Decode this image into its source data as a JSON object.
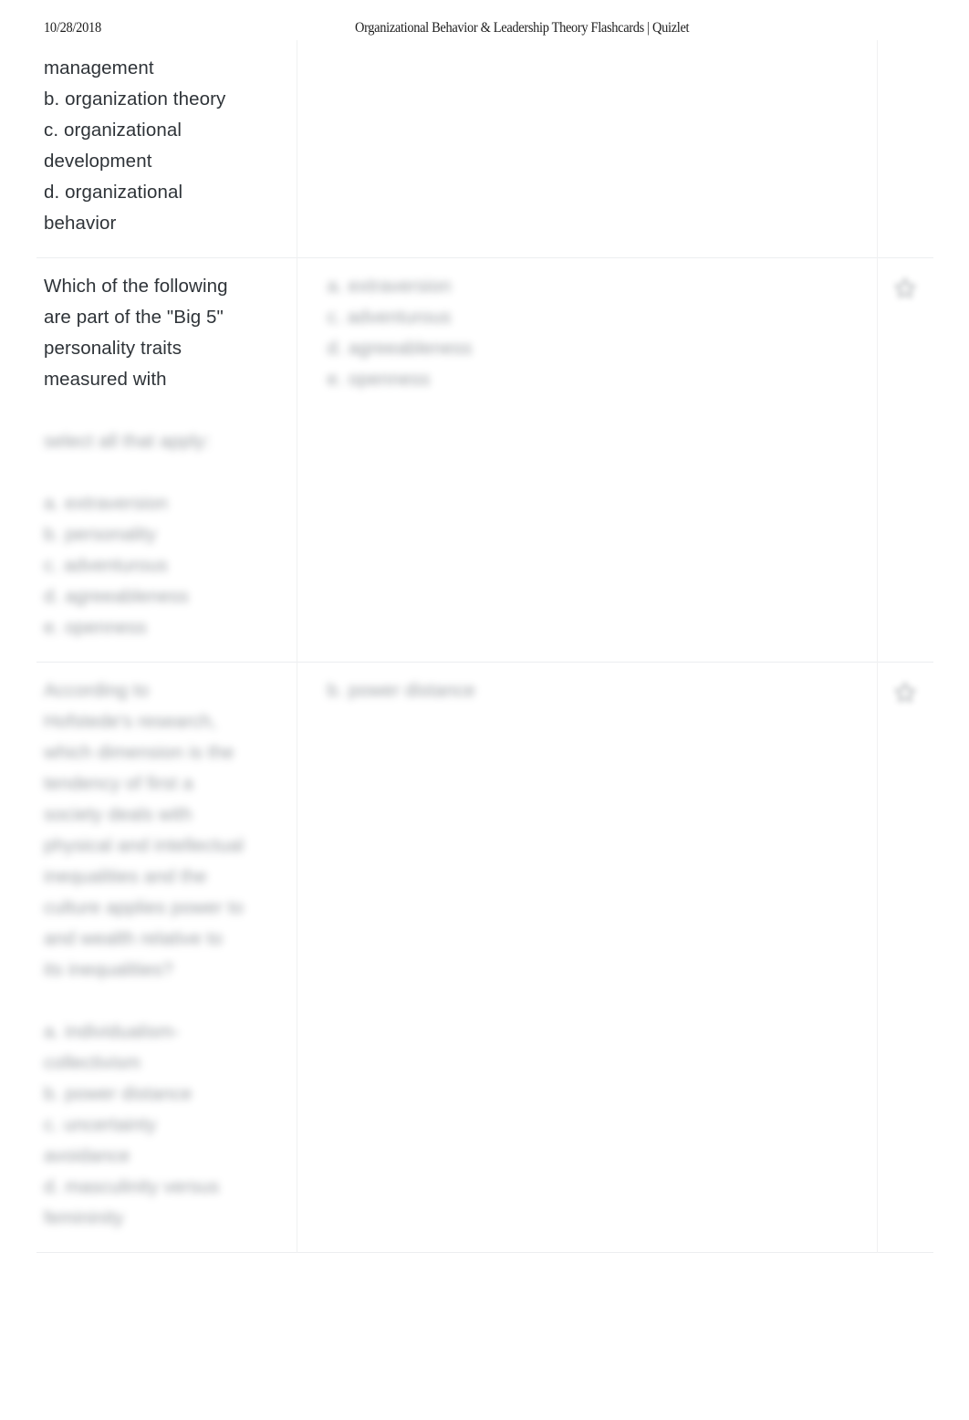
{
  "print_header": {
    "date": "10/28/2018",
    "title": "Organizational Behavior & Leadership Theory Flashcards | Quizlet"
  },
  "cards": [
    {
      "id": "card-1",
      "term_lines": [
        "management",
        "b. organization theory",
        "c. organizational",
        "development",
        "d. organizational",
        "behavior"
      ],
      "definition_lines": [],
      "blurred_term_lines": [],
      "blurred_definition_lines": [],
      "has_action_icon": false,
      "action_icon": ""
    },
    {
      "id": "card-2",
      "term_lines": [
        "Which of the following",
        "are part of the \"Big 5\"",
        "personality traits",
        "measured with"
      ],
      "blurred_term_lines": [
        "select all that apply:",
        "",
        "",
        "a. extraversion",
        "b. personality",
        "c. adventurous",
        "d. agreeableness",
        "e. openness"
      ],
      "blurred_definition_lines": [
        "a. extraversion",
        "c. adventurous",
        "d. agreeableness",
        "e. openness"
      ],
      "has_action_icon": true,
      "action_icon": "star-icon"
    },
    {
      "id": "card-3",
      "term_lines": [],
      "blurred_term_lines": [
        "According to",
        "Hofstede's research,",
        "which dimension is the",
        "tendency of first a",
        "society deals with",
        "physical and intellectual",
        "inequalities and the",
        "culture applies power to",
        "and wealth relative to",
        "its inequalities?",
        "",
        "a. individualism-",
        "collectivism",
        "b. power distance",
        "c. uncertainty",
        "avoidance",
        "d. masculinity versus",
        "femininity"
      ],
      "blurred_definition_lines": [
        "b. power distance"
      ],
      "has_action_icon": true,
      "action_icon": "star-icon"
    }
  ]
}
